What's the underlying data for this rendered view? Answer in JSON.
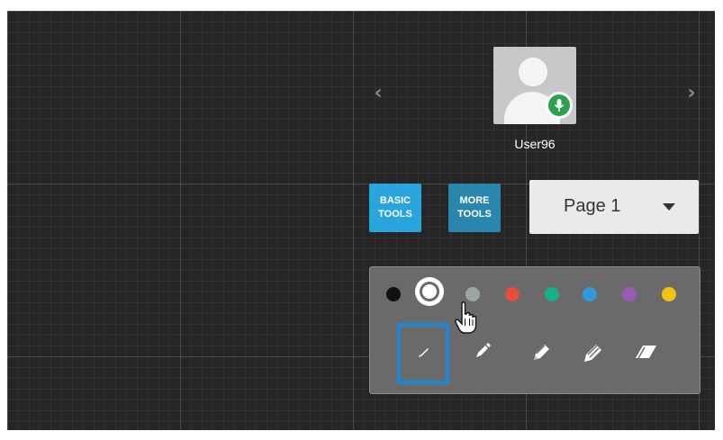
{
  "user": {
    "name": "User96",
    "mic_status": "unmuted"
  },
  "icons": {
    "prev": "‹",
    "next": "›",
    "avatar": "user-avatar-icon",
    "mic": "microphone-icon",
    "page_caret": "chevron-down-icon",
    "cursor": "hand-pointer-icon",
    "tools": [
      "thin-pencil-icon",
      "pencil-icon",
      "thick-pencil-icon",
      "brush-icon",
      "eraser-icon"
    ]
  },
  "toolbar": {
    "basic_tools": {
      "line1": "BASIC",
      "line2": "TOOLS"
    },
    "more_tools": {
      "line1": "MORE",
      "line2": "TOOLS"
    }
  },
  "page_select": {
    "selected_label": "Page 1"
  },
  "palette": {
    "selected_color": "#ffffff",
    "colors": [
      {
        "name": "black",
        "hex": "#111111"
      },
      {
        "name": "white",
        "hex": "#ffffff"
      },
      {
        "name": "gray",
        "hex": "#9aa6a6"
      },
      {
        "name": "red",
        "hex": "#e74c3c"
      },
      {
        "name": "green",
        "hex": "#16b08a"
      },
      {
        "name": "blue",
        "hex": "#3498db"
      },
      {
        "name": "purple",
        "hex": "#9b59b6"
      },
      {
        "name": "yellow",
        "hex": "#f1c40f"
      }
    ],
    "active_tool": "thin-pencil"
  },
  "theme": {
    "board_bg": "#262626",
    "basic_tab_bg": "#29a4dc",
    "more_tab_bg": "#2a86ac",
    "active_tool_border": "#1f86d6",
    "avatar_bg": "#c8c8c8",
    "mic_badge": "#2aa14b"
  }
}
